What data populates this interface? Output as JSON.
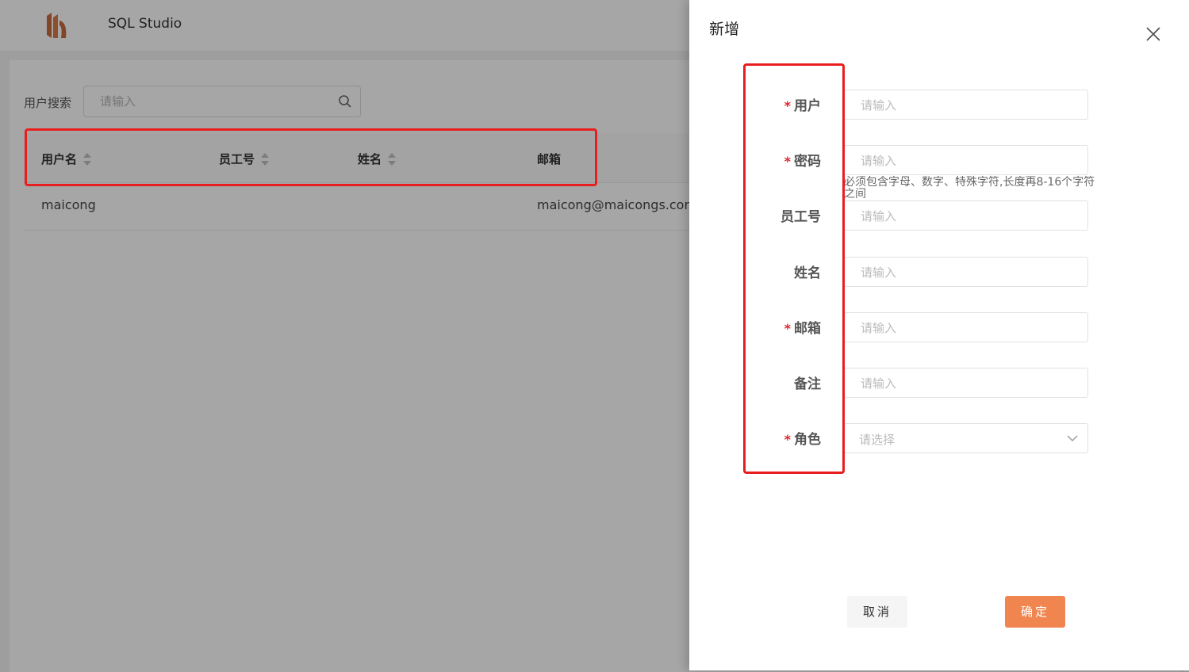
{
  "app": {
    "title": "SQL Studio"
  },
  "search": {
    "label": "用户搜索",
    "placeholder": "请输入"
  },
  "table": {
    "columns": [
      {
        "label": "用户名",
        "sortable": true
      },
      {
        "label": "员工号",
        "sortable": true
      },
      {
        "label": "姓名",
        "sortable": true
      },
      {
        "label": "邮箱",
        "sortable": false
      }
    ],
    "rows": [
      {
        "username": "maicong",
        "employee_no": "",
        "name": "",
        "email": "maicong@maicongs.com"
      }
    ]
  },
  "drawer": {
    "title": "新增",
    "fields": [
      {
        "label": "用户",
        "required": true,
        "placeholder": "请输入"
      },
      {
        "label": "密码",
        "required": true,
        "placeholder": "请输入",
        "hint": "必须包含字母、数字、特殊字符,长度再8-16个字符之间"
      },
      {
        "label": "员工号",
        "required": false,
        "placeholder": "请输入"
      },
      {
        "label": "姓名",
        "required": false,
        "placeholder": "请输入"
      },
      {
        "label": "邮箱",
        "required": true,
        "placeholder": "请输入"
      },
      {
        "label": "备注",
        "required": false,
        "placeholder": "请输入"
      },
      {
        "label": "角色",
        "required": true,
        "placeholder": "请选择"
      }
    ],
    "required_mark": "*",
    "cancel_label": "取消",
    "ok_label": "确定"
  },
  "colors": {
    "accent": "#f0854f",
    "highlight": "#e81e1e",
    "required": "#e0242b"
  }
}
